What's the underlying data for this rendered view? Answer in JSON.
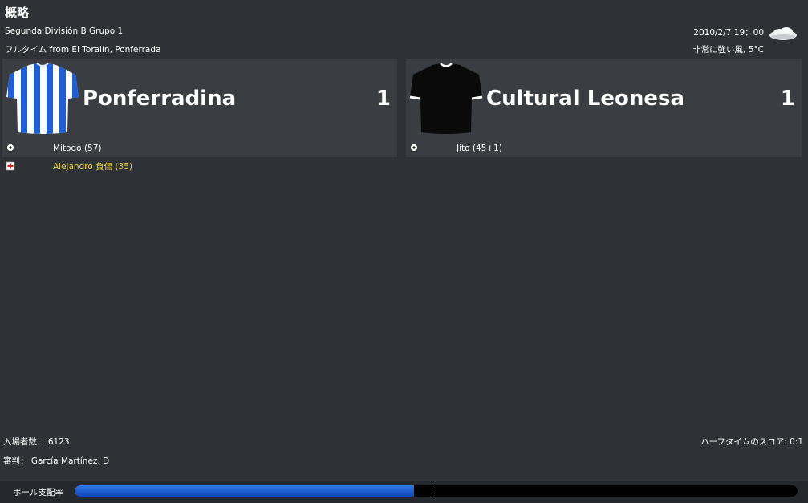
{
  "header": {
    "title": "概略",
    "competition": "Segunda División B Grupo 1",
    "status": "フルタイム from El Toralín, Ponferrada",
    "datetime": "2010/2/7 19：00",
    "weather": "非常に強い風, 5°C",
    "weather_icon": "cloud-icon"
  },
  "home": {
    "name": "Ponferradina",
    "score": "1",
    "shirt_colors": [
      "#1c5fd6",
      "#ffffff"
    ],
    "events": [
      {
        "type": "goal",
        "icon": "ball-icon",
        "text": "Mitogo (57)"
      },
      {
        "type": "injury",
        "icon": "injury-icon",
        "text": "Alejandro 負傷 (35)"
      }
    ]
  },
  "away": {
    "name": "Cultural Leonesa",
    "score": "1",
    "shirt_colors": [
      "#0a0a0a",
      "#ffffff"
    ],
    "events": [
      {
        "type": "goal",
        "icon": "ball-icon",
        "text": "Jito (45+1)"
      }
    ]
  },
  "footer": {
    "attendance": "入場者数： 6123",
    "halftime": "ハーフタイムのスコア: 0:1",
    "referee": "審判： García Martínez, D",
    "possession_label": "ボール支配率",
    "possession_home_fraction": 0.47,
    "colors": {
      "accent": "#1c5fd6",
      "injury": "#f0d23a"
    }
  }
}
